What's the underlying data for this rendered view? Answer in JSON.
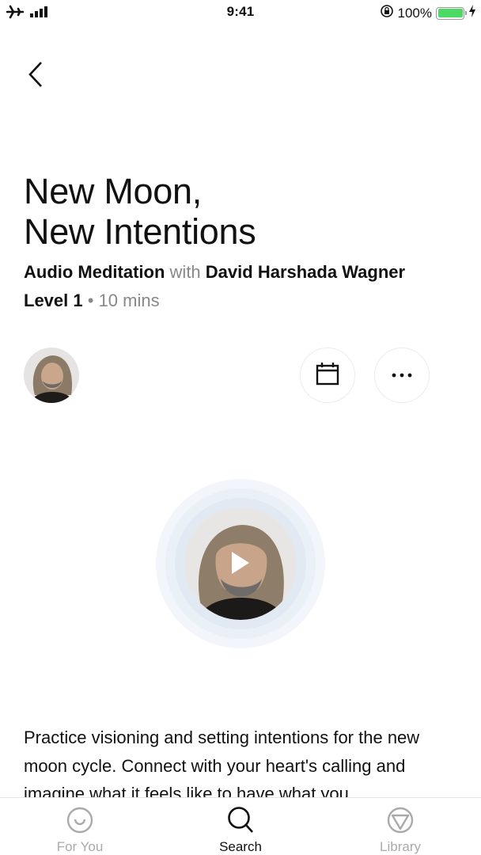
{
  "status_bar": {
    "time": "9:41",
    "battery_percent": "100%",
    "battery_level": 1.0,
    "icons": [
      "airplane-icon",
      "signal-icon",
      "orientation-lock-icon",
      "battery-icon",
      "charging-bolt-icon"
    ]
  },
  "nav": {
    "back_icon": "chevron-left-icon"
  },
  "session": {
    "title_line1": "New Moon,",
    "title_line2": "New Intentions",
    "type": "Audio Meditation",
    "with": "with",
    "teacher": "David Harshada Wagner",
    "level": "Level 1",
    "separator": "•",
    "duration": "10 mins",
    "description": "Practice visioning and setting intentions for the new moon cycle. Connect with your heart's calling and imagine what it feels like to have what you"
  },
  "actions": {
    "calendar_icon": "calendar-icon",
    "more_icon": "more-horizontal-icon"
  },
  "player": {
    "play_icon": "play-icon"
  },
  "tab_bar": {
    "tabs": [
      {
        "label": "For You",
        "icon": "smile-icon",
        "active": false
      },
      {
        "label": "Search",
        "icon": "search-icon",
        "active": true
      },
      {
        "label": "Library",
        "icon": "triangle-circle-icon",
        "active": false
      }
    ]
  },
  "colors": {
    "accent_text": "#111111",
    "muted_text": "#888888",
    "inactive_tab": "#aaaaaa",
    "battery_green": "#4cd964",
    "ring_light": "#e9f0f6"
  }
}
